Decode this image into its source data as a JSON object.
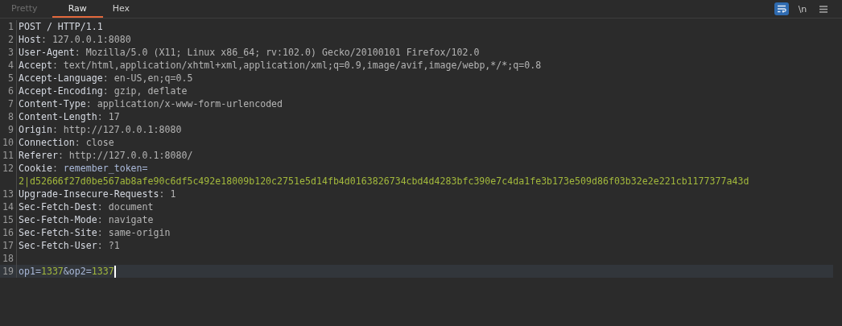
{
  "tabs": [
    {
      "label": "Pretty",
      "selected": false,
      "disabled": true
    },
    {
      "label": "Raw",
      "selected": true,
      "disabled": false
    },
    {
      "label": "Hex",
      "selected": false,
      "disabled": false
    }
  ],
  "toolbar": [
    {
      "kind": "wrap",
      "on": true
    },
    {
      "kind": "newline",
      "label": "\\n",
      "on": false
    },
    {
      "kind": "menu"
    }
  ],
  "lines": [
    {
      "number": "1",
      "current": false,
      "segments": [
        {
          "kind": "plain",
          "text": "POST / HTTP/1.1"
        }
      ]
    },
    {
      "number": "2",
      "current": false,
      "segments": [
        {
          "kind": "name",
          "text": "Host"
        },
        {
          "kind": "sep",
          "text": ": "
        },
        {
          "kind": "value",
          "text": "127.0.0.1:8080"
        }
      ]
    },
    {
      "number": "3",
      "current": false,
      "segments": [
        {
          "kind": "name",
          "text": "User-Agent"
        },
        {
          "kind": "sep",
          "text": ": "
        },
        {
          "kind": "value",
          "text": "Mozilla/5.0 (X11; Linux x86_64; rv:102.0) Gecko/20100101 Firefox/102.0"
        }
      ]
    },
    {
      "number": "4",
      "current": false,
      "segments": [
        {
          "kind": "name",
          "text": "Accept"
        },
        {
          "kind": "sep",
          "text": ": "
        },
        {
          "kind": "value",
          "text": "text/html,application/xhtml+xml,application/xml;q=0.9,image/avif,image/webp,*/*;q=0.8"
        }
      ]
    },
    {
      "number": "5",
      "current": false,
      "segments": [
        {
          "kind": "name",
          "text": "Accept-Language"
        },
        {
          "kind": "sep",
          "text": ": "
        },
        {
          "kind": "value",
          "text": "en-US,en;q=0.5"
        }
      ]
    },
    {
      "number": "6",
      "current": false,
      "segments": [
        {
          "kind": "name",
          "text": "Accept-Encoding"
        },
        {
          "kind": "sep",
          "text": ": "
        },
        {
          "kind": "value",
          "text": "gzip, deflate"
        }
      ]
    },
    {
      "number": "7",
      "current": false,
      "segments": [
        {
          "kind": "name",
          "text": "Content-Type"
        },
        {
          "kind": "sep",
          "text": ": "
        },
        {
          "kind": "value",
          "text": "application/x-www-form-urlencoded"
        }
      ]
    },
    {
      "number": "8",
      "current": false,
      "segments": [
        {
          "kind": "name",
          "text": "Content-Length"
        },
        {
          "kind": "sep",
          "text": ": "
        },
        {
          "kind": "value",
          "text": "17"
        }
      ]
    },
    {
      "number": "9",
      "current": false,
      "segments": [
        {
          "kind": "name",
          "text": "Origin"
        },
        {
          "kind": "sep",
          "text": ": "
        },
        {
          "kind": "value",
          "text": "http://127.0.0.1:8080"
        }
      ]
    },
    {
      "number": "10",
      "current": false,
      "segments": [
        {
          "kind": "name",
          "text": "Connection"
        },
        {
          "kind": "sep",
          "text": ": "
        },
        {
          "kind": "value",
          "text": "close"
        }
      ]
    },
    {
      "number": "11",
      "current": false,
      "segments": [
        {
          "kind": "name",
          "text": "Referer"
        },
        {
          "kind": "sep",
          "text": ": "
        },
        {
          "kind": "value",
          "text": "http://127.0.0.1:8080/"
        }
      ]
    },
    {
      "number": "12",
      "current": false,
      "segments": [
        {
          "kind": "name",
          "text": "Cookie"
        },
        {
          "kind": "sep",
          "text": ": "
        },
        {
          "kind": "param",
          "text": "remember_token="
        }
      ]
    },
    {
      "current": false,
      "segments": [
        {
          "kind": "paramvalue",
          "text": "2|d52666f27d0be567ab8afe90c6df5c492e18009b120c2751e5d14fb4d0163826734cbd4d4283bfc390e7c4da1fe3b173e509d86f03b32e2e221cb1177377a43d"
        }
      ]
    },
    {
      "number": "13",
      "current": false,
      "segments": [
        {
          "kind": "name",
          "text": "Upgrade-Insecure-Requests"
        },
        {
          "kind": "sep",
          "text": ": "
        },
        {
          "kind": "value",
          "text": "1"
        }
      ]
    },
    {
      "number": "14",
      "current": false,
      "segments": [
        {
          "kind": "name",
          "text": "Sec-Fetch-Dest"
        },
        {
          "kind": "sep",
          "text": ": "
        },
        {
          "kind": "value",
          "text": "document"
        }
      ]
    },
    {
      "number": "15",
      "current": false,
      "segments": [
        {
          "kind": "name",
          "text": "Sec-Fetch-Mode"
        },
        {
          "kind": "sep",
          "text": ": "
        },
        {
          "kind": "value",
          "text": "navigate"
        }
      ]
    },
    {
      "number": "16",
      "current": false,
      "segments": [
        {
          "kind": "name",
          "text": "Sec-Fetch-Site"
        },
        {
          "kind": "sep",
          "text": ": "
        },
        {
          "kind": "value",
          "text": "same-origin"
        }
      ]
    },
    {
      "number": "17",
      "current": false,
      "segments": [
        {
          "kind": "name",
          "text": "Sec-Fetch-User"
        },
        {
          "kind": "sep",
          "text": ": "
        },
        {
          "kind": "value",
          "text": "?1"
        }
      ]
    },
    {
      "number": "18",
      "current": false
    },
    {
      "number": "19",
      "current": true,
      "segments": [
        {
          "kind": "param",
          "text": "op1="
        },
        {
          "kind": "paramvalue",
          "text": "1337"
        },
        {
          "kind": "param",
          "text": "&op2="
        },
        {
          "kind": "paramvalue",
          "text": "1337"
        }
      ]
    }
  ]
}
